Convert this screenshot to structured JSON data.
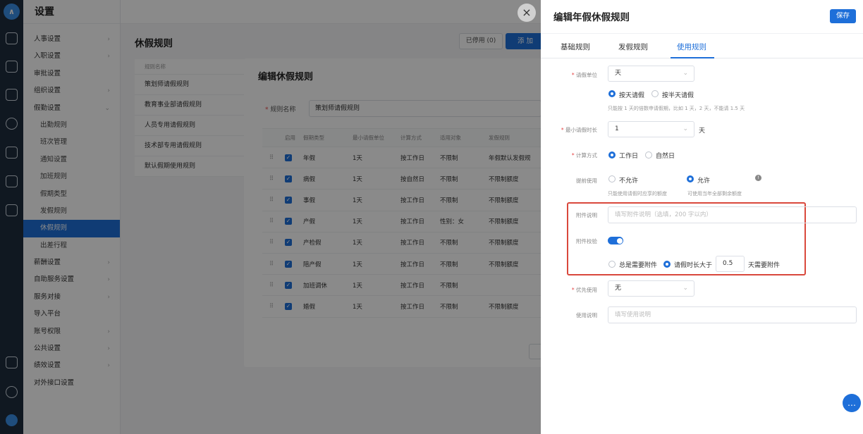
{
  "sidebar": {
    "title": "设置",
    "items": [
      {
        "label": "人事设置",
        "chev": "›",
        "sub": false
      },
      {
        "label": "入职设置",
        "chev": "›",
        "sub": false
      },
      {
        "label": "审批设置",
        "chev": "",
        "sub": false
      },
      {
        "label": "组织设置",
        "chev": "›",
        "sub": false
      },
      {
        "label": "假勤设置",
        "chev": "⌄",
        "sub": false
      },
      {
        "label": "出勤规则",
        "chev": "",
        "sub": true
      },
      {
        "label": "班次管理",
        "chev": "",
        "sub": true
      },
      {
        "label": "通知设置",
        "chev": "",
        "sub": true
      },
      {
        "label": "加班规则",
        "chev": "",
        "sub": true
      },
      {
        "label": "假期类型",
        "chev": "",
        "sub": true
      },
      {
        "label": "发假规则",
        "chev": "",
        "sub": true
      },
      {
        "label": "休假规则",
        "chev": "",
        "sub": true,
        "active": true
      },
      {
        "label": "出差行程",
        "chev": "",
        "sub": true
      },
      {
        "label": "薪酬设置",
        "chev": "›",
        "sub": false
      },
      {
        "label": "自助服务设置",
        "chev": "›",
        "sub": false
      },
      {
        "label": "服务对接",
        "chev": "›",
        "sub": false
      },
      {
        "label": "导入平台",
        "chev": "",
        "sub": false
      },
      {
        "label": "账号权限",
        "chev": "›",
        "sub": false
      },
      {
        "label": "公共设置",
        "chev": "›",
        "sub": false
      },
      {
        "label": "绩效设置",
        "chev": "›",
        "sub": false
      },
      {
        "label": "对外接口设置",
        "chev": "",
        "sub": false
      }
    ]
  },
  "page": {
    "title": "休假规则",
    "disabled_btn": "已停用 (0)",
    "add_btn": "添 加",
    "rules_header": "规则名称",
    "rules": [
      "策划师请假规则",
      "教育事业部请假规则",
      "人员专用请假规则",
      "技术部专用请假规则",
      "默认假期使用规则"
    ]
  },
  "modal": {
    "title": "编辑休假规则",
    "name_label": "规则名称",
    "name_value": "策划师请假规则",
    "columns": [
      "",
      "启用",
      "假期类型",
      "最小请假单位",
      "计算方式",
      "适用对象",
      "发假规则"
    ],
    "rows": [
      [
        "年假",
        "1天",
        "按工作日",
        "不限制",
        "年假默认发假规"
      ],
      [
        "病假",
        "1天",
        "按自然日",
        "不限制",
        "不限制额度"
      ],
      [
        "事假",
        "1天",
        "按工作日",
        "不限制",
        "不限制额度"
      ],
      [
        "产假",
        "1天",
        "按工作日",
        "性别：女",
        "不限制额度"
      ],
      [
        "产检假",
        "1天",
        "按工作日",
        "不限制",
        "不限制额度"
      ],
      [
        "陪产假",
        "1天",
        "按工作日",
        "不限制",
        "不限制额度"
      ],
      [
        "加班调休",
        "1天",
        "按工作日",
        "不限制",
        ""
      ],
      [
        "婚假",
        "1天",
        "按工作日",
        "不限制",
        "不限制额度"
      ]
    ]
  },
  "drawer": {
    "title": "编辑年假休假规则",
    "save": "保存",
    "tabs": [
      "基础规则",
      "发假规则",
      "使用规则"
    ],
    "active_tab": 2,
    "unit_label": "请假单位",
    "unit_value": "天",
    "unit_opt1": "按天请假",
    "unit_opt2": "按半天请假",
    "unit_hint": "只能按 1 天的倍数申请假期，比如 1 天，2 天，不能请 1.5 天",
    "min_label": "最小请假时长",
    "min_value": "1",
    "min_unit": "天",
    "calc_label": "计算方式",
    "calc_opt1": "工作日",
    "calc_opt2": "自然日",
    "advance_label": "提前使用",
    "advance_opt1": "不允许",
    "advance_opt2": "允许",
    "advance_hint1": "只能使用请假时应享的额度",
    "advance_hint2": "可使用当年全部剩余额度",
    "attach_desc_label": "附件说明",
    "attach_desc_placeholder": "填写附件说明（选填，200 字以内）",
    "attach_check_label": "附件校验",
    "attach_opt1": "总是需要附件",
    "attach_opt2": "请假时长大于",
    "attach_days": "0.5",
    "attach_suffix": "天需要附件",
    "priority_label": "优先使用",
    "priority_value": "无",
    "usage_label": "使用说明",
    "usage_placeholder": "填写使用说明"
  },
  "icons": {
    "close": "×",
    "check": "✓",
    "drag": "⠿",
    "arrow": "⌄",
    "info": "!",
    "chat": "…"
  },
  "colors": {
    "primary": "#1e6fd9",
    "highlight_border": "#d9483c",
    "required": "#e54545"
  }
}
